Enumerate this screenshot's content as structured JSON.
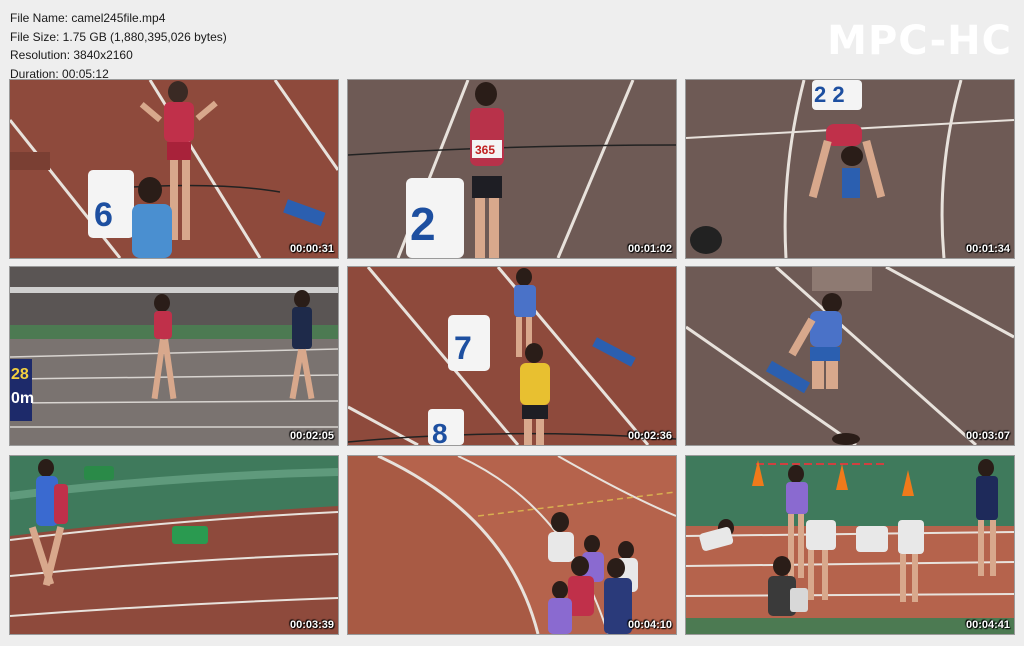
{
  "info": {
    "file_name": "File Name: camel245file.mp4",
    "file_size": "File Size: 1.75 GB (1,880,395,026 bytes)",
    "resolution": "Resolution: 3840x2160",
    "duration": "Duration: 00:05:12"
  },
  "logo": "MPC-HC",
  "thumbnails": [
    {
      "timestamp": "00:00:31"
    },
    {
      "timestamp": "00:01:02"
    },
    {
      "timestamp": "00:01:34"
    },
    {
      "timestamp": "00:02:05"
    },
    {
      "timestamp": "00:02:36"
    },
    {
      "timestamp": "00:03:07"
    },
    {
      "timestamp": "00:03:39"
    },
    {
      "timestamp": "00:04:10"
    },
    {
      "timestamp": "00:04:41"
    }
  ],
  "scene_text": {
    "lane_6": "6",
    "lane_2": "2",
    "lane_2_top": "2 2",
    "lane_7": "7",
    "lane_8": "8",
    "bib_365": "365",
    "board_28": "28",
    "board_0m": "0m"
  },
  "colors": {
    "track_red": "#8e4a3c",
    "track_wet": "#6e5a55",
    "track_orange": "#b5634c",
    "infield_green": "#3f7a5c",
    "lane_line": "#e8e2dc"
  }
}
